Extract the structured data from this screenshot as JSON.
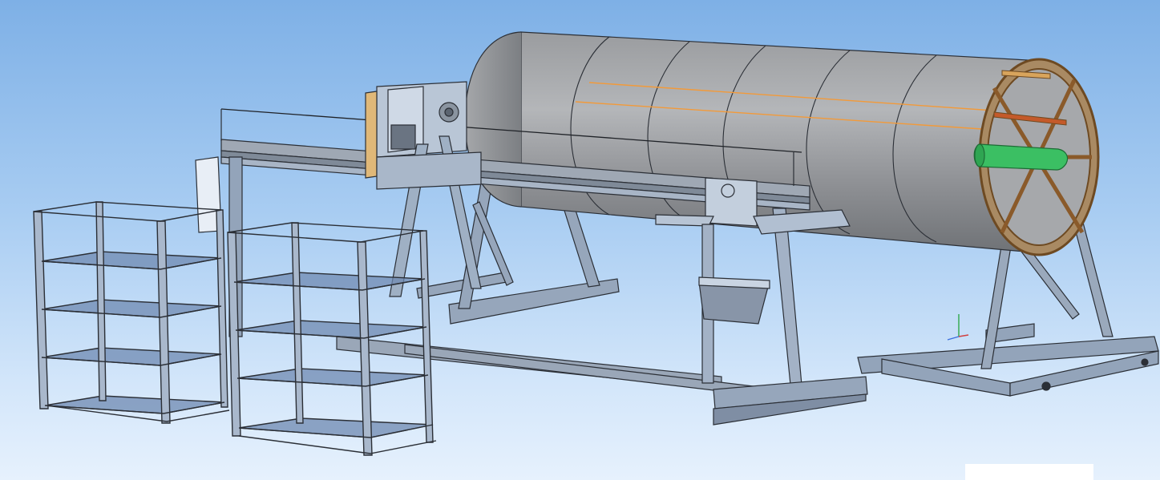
{
  "viewport": {
    "background_top": "#7eb0e6",
    "background_bottom": "#e6f1fd"
  },
  "colors": {
    "steel_frame": "#9aa7b8",
    "steel_edge": "#2b2f36",
    "shelf_fill": "#6f89b2",
    "drum_fill": "#8d8f93",
    "drum_highlight": "#b4b6b9",
    "wheel_ring": "#9a6a34",
    "shaft": "#3bbf63",
    "guide_lines": "#f29a3a",
    "panel_fill": "#e8eef6"
  }
}
